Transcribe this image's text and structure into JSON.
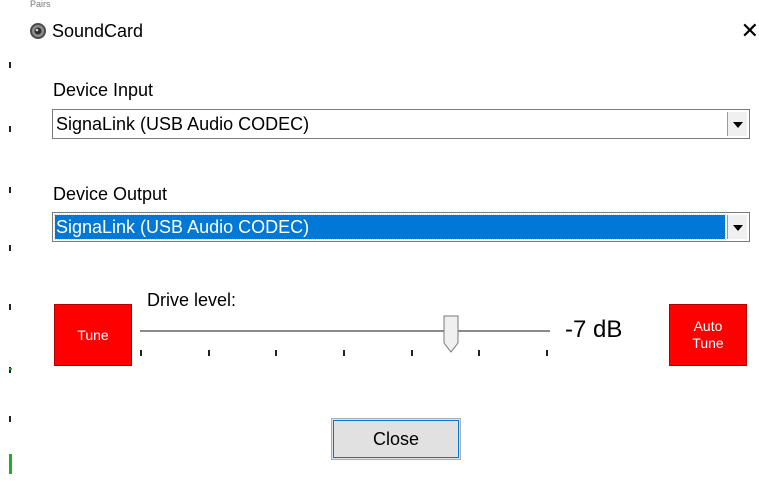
{
  "window": {
    "title": "SoundCard",
    "close_glyph": "✕",
    "top_strip_text": "Pairs"
  },
  "device_input": {
    "label": "Device Input",
    "value": "SignaLink (USB Audio CODEC)"
  },
  "device_output": {
    "label": "Device Output",
    "value": "SignaLink (USB Audio CODEC)"
  },
  "tune_button": {
    "label": "Tune"
  },
  "drive": {
    "label": "Drive level:",
    "value_text": "-7 dB",
    "slider_ticks": 7
  },
  "auto_tune_button": {
    "line1": "Auto",
    "line2": "Tune"
  },
  "close_button": {
    "label": "Close"
  },
  "icons": {
    "title": "speaker-icon",
    "dropdown": "chevron-down-icon"
  },
  "colors": {
    "tune_red": "#ff0000",
    "selection_blue": "#0078d7",
    "focus_blue": "#0078d7",
    "button_gray": "#e1e1e1"
  }
}
